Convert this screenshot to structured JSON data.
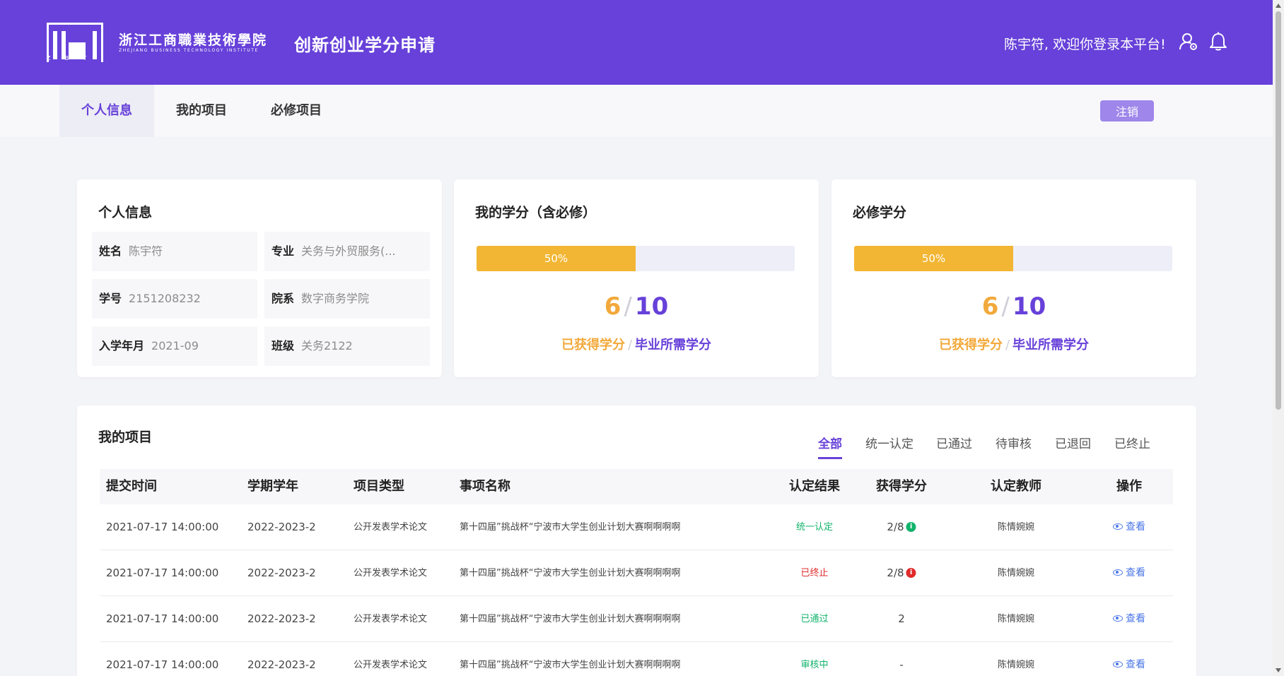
{
  "header": {
    "logo_letters": [
      "Z",
      "B",
      "T",
      "I"
    ],
    "school_name_cn": "浙江工商職業技術學院",
    "school_name_en": "ZHEJIANG BUSINESS TECHNOLOGY INSTITUTE",
    "app_title": "创新创业学分申请",
    "welcome": "陈宇符, 欢迎你登录本平台!",
    "icons": [
      "user-settings-icon",
      "bell-icon"
    ],
    "colors": {
      "brand": "#6741d9"
    }
  },
  "nav": {
    "tabs": [
      {
        "label": "个人信息",
        "active": true
      },
      {
        "label": "我的项目",
        "active": false
      },
      {
        "label": "必修项目",
        "active": false
      }
    ],
    "logout_label": "注销"
  },
  "personal_info": {
    "title": "个人信息",
    "fields": [
      {
        "label": "姓名",
        "value": "陈宇符"
      },
      {
        "label": "专业",
        "value": "关务与外贸服务(..."
      },
      {
        "label": "学号",
        "value": "2151208232"
      },
      {
        "label": "院系",
        "value": "数字商务学院"
      },
      {
        "label": "入学年月",
        "value": "2021-09"
      },
      {
        "label": "班级",
        "value": "关务2122"
      }
    ]
  },
  "my_credits": {
    "title": "我的学分（含必修）",
    "progress_percent": 50,
    "progress_label": "50%",
    "earned": "6",
    "required": "10",
    "separator": "/",
    "earned_label": "已获得学分",
    "required_label": "毕业所需学分"
  },
  "required_credits": {
    "title": "必修学分",
    "progress_percent": 50,
    "progress_label": "50%",
    "earned": "6",
    "required": "10",
    "separator": "/",
    "earned_label": "已获得学分",
    "required_label": "毕业所需学分"
  },
  "projects": {
    "title": "我的项目",
    "filters": [
      {
        "label": "全部",
        "active": true
      },
      {
        "label": "统一认定",
        "active": false
      },
      {
        "label": "已通过",
        "active": false
      },
      {
        "label": "待审核",
        "active": false
      },
      {
        "label": "已退回",
        "active": false
      },
      {
        "label": "已终止",
        "active": false
      }
    ],
    "columns": [
      "提交时间",
      "学期学年",
      "项目类型",
      "事项名称",
      "认定结果",
      "获得学分",
      "认定教师",
      "操作"
    ],
    "rows": [
      {
        "time": "2021-07-17 14:00:00",
        "term": "2022-2023-2",
        "type": "公开发表学术论文",
        "name": "第十四届”挑战杯“宁波市大学生创业计划大赛啊啊啊啊",
        "result": "统一认定",
        "result_color": "#11b36b",
        "credits": "2/8",
        "info": "green",
        "teacher": "陈情婉婉",
        "action": "查看"
      },
      {
        "time": "2021-07-17 14:00:00",
        "term": "2022-2023-2",
        "type": "公开发表学术论文",
        "name": "第十四届”挑战杯“宁波市大学生创业计划大赛啊啊啊啊",
        "result": "已终止",
        "result_color": "#e02b2b",
        "credits": "2/8",
        "info": "red",
        "teacher": "陈情婉婉",
        "action": "查看"
      },
      {
        "time": "2021-07-17 14:00:00",
        "term": "2022-2023-2",
        "type": "公开发表学术论文",
        "name": "第十四届”挑战杯“宁波市大学生创业计划大赛啊啊啊啊",
        "result": "已通过",
        "result_color": "#11b36b",
        "credits": "2",
        "info": "",
        "teacher": "陈情婉婉",
        "action": "查看"
      },
      {
        "time": "2021-07-17 14:00:00",
        "term": "2022-2023-2",
        "type": "公开发表学术论文",
        "name": "第十四届”挑战杯“宁波市大学生创业计划大赛啊啊啊啊",
        "result": "审核中",
        "result_color": "#11b36b",
        "credits": "-",
        "info": "",
        "teacher": "陈情婉婉",
        "action": "查看"
      }
    ],
    "info_glyph": "i"
  }
}
